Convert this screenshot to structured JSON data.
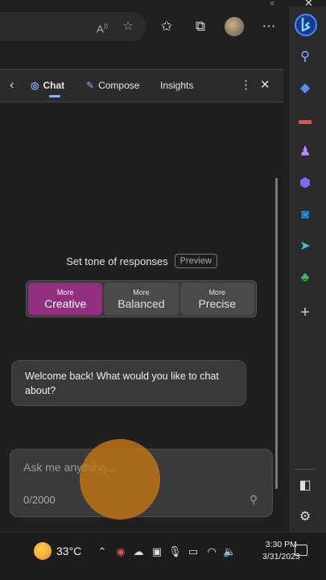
{
  "browser": {
    "read_aloud_icon": "read-aloud-icon",
    "toolbar_icons": [
      "read-aloud-icon",
      "add-favorite-icon",
      "favorites-icon",
      "collections-icon",
      "profile-avatar",
      "more-options-icon"
    ]
  },
  "chat_panel": {
    "tabs": [
      {
        "label": "Chat",
        "active": true
      },
      {
        "label": "Compose",
        "active": false
      },
      {
        "label": "Insights",
        "active": false
      }
    ],
    "tone": {
      "title": "Set tone of responses",
      "badge": "Preview",
      "options": [
        {
          "small": "More",
          "big": "Creative",
          "active": true
        },
        {
          "small": "More",
          "big": "Balanced",
          "active": false
        },
        {
          "small": "More",
          "big": "Precise",
          "active": false
        }
      ]
    },
    "welcome_message": "Welcome back! What would you like to chat about?",
    "input": {
      "placeholder": "Ask me anything...",
      "char_count": "0/2000"
    }
  },
  "sidebar": {
    "items": [
      "search-icon",
      "tag-icon",
      "toolbox-icon",
      "games-icon",
      "office-icon",
      "outlook-icon",
      "send-icon",
      "tree-icon",
      "add-icon",
      "sidebar-toggle-icon",
      "settings-icon"
    ]
  },
  "taskbar": {
    "temperature": "33°C",
    "time": "3:30 PM",
    "date": "3/31/2023"
  },
  "colors": {
    "accent_creative": "#92307f",
    "panel_bg": "#2b2b2b",
    "chat_bg": "#1f1f1f"
  }
}
